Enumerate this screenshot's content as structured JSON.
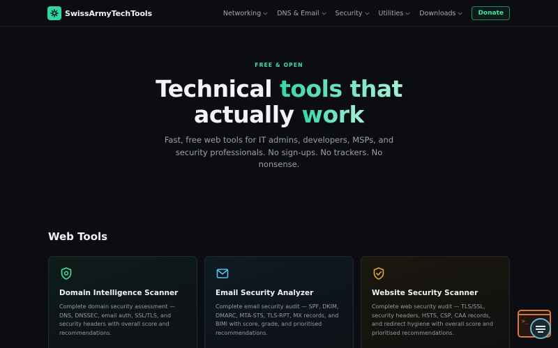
{
  "brand": {
    "name": "SwissArmyTechTools",
    "accent": "#2fd6a0"
  },
  "nav": {
    "items": [
      {
        "label": "Networking"
      },
      {
        "label": "DNS & Email"
      },
      {
        "label": "Security"
      },
      {
        "label": "Utilities"
      },
      {
        "label": "Downloads"
      }
    ],
    "donate_label": "Donate"
  },
  "hero": {
    "eyebrow": "FREE & OPEN",
    "title_part1": "Technical ",
    "title_highlight1": "tools that",
    "title_part2": "actually ",
    "title_highlight2": "work",
    "subtitle": "Fast, free web tools for IT admins, developers, MSPs, and security professionals. No sign-ups. No trackers. No nonsense."
  },
  "web_tools": {
    "heading": "Web Tools",
    "cards": [
      {
        "icon": "shield-icon",
        "icon_color": "#3ee3a4",
        "title": "Domain Intelligence Scanner",
        "description": "Complete domain security assessment — DNS, DNSSEC, email auth, SSL/TLS, and security headers with overall score and recommendations."
      },
      {
        "icon": "mail-icon",
        "icon_color": "#4fc3e8",
        "title": "Email Security Analyzer",
        "description": "Complete email security audit — SPF, DKIM, DMARC, MTA-STS, TLS-RPT, MX records, and BIMI with score, grade, and prioritised recommendations."
      },
      {
        "icon": "shield-check-icon",
        "icon_color": "#e8a53a",
        "title": "Website Security Scanner",
        "description": "Complete web security audit — TLS/SSL, security headers, HSTS, CSP, CAA records, and redirect hygiene with overall score and prioritised recommendations."
      }
    ]
  },
  "widget": {
    "icon": "terminal-icon",
    "prompt": ">_"
  }
}
